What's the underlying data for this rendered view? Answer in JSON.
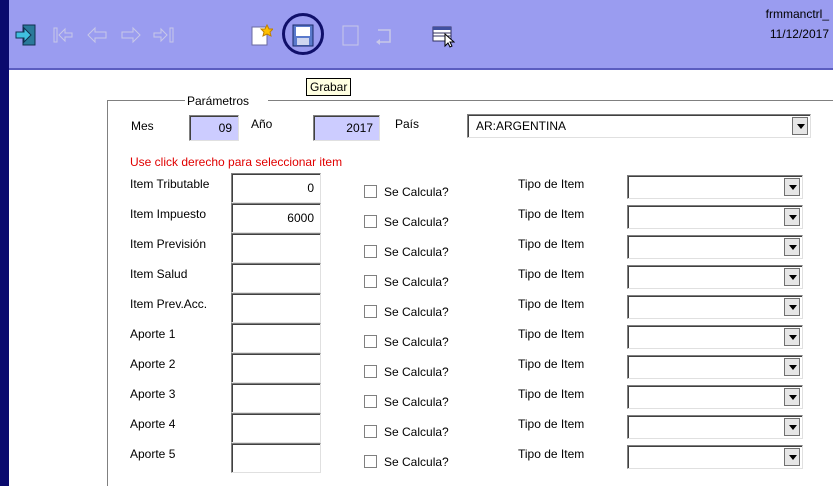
{
  "window": {
    "form_name": "frmmanctrl_",
    "date": "11/12/2017"
  },
  "toolbar": {
    "icons": [
      "exit-icon",
      "first-record-icon",
      "previous-record-icon",
      "next-record-icon",
      "last-record-icon",
      "new-record-icon",
      "save-icon",
      "blank-page-icon",
      "undo-icon",
      "grid-icon"
    ],
    "tooltip": "Grabar"
  },
  "params": {
    "group_title": "Parámetros",
    "mes_label": "Mes",
    "mes_value": "09",
    "anio_label": "Año",
    "anio_value": "2017",
    "pais_label": "País",
    "pais_value": "AR:ARGENTINA"
  },
  "hint": "Use click derecho para seleccionar item",
  "rows": [
    {
      "label": "Item Tributable",
      "value": "0",
      "calc": "Se Calcula?",
      "tipo": "Tipo de Item"
    },
    {
      "label": "Item Impuesto",
      "value": "6000",
      "calc": "Se Calcula?",
      "tipo": "Tipo de Item"
    },
    {
      "label": "Item Previsión",
      "value": "",
      "calc": "Se Calcula?",
      "tipo": "Tipo de Item"
    },
    {
      "label": "Item Salud",
      "value": "",
      "calc": "Se Calcula?",
      "tipo": "Tipo de Item"
    },
    {
      "label": "Item Prev.Acc.",
      "value": "",
      "calc": "Se Calcula?",
      "tipo": "Tipo de Item"
    },
    {
      "label": "Aporte 1",
      "value": "",
      "calc": "Se Calcula?",
      "tipo": "Tipo de Item"
    },
    {
      "label": "Aporte 2",
      "value": "",
      "calc": "Se Calcula?",
      "tipo": "Tipo de Item"
    },
    {
      "label": "Aporte 3",
      "value": "",
      "calc": "Se Calcula?",
      "tipo": "Tipo de Item"
    },
    {
      "label": "Aporte 4",
      "value": "",
      "calc": "Se Calcula?",
      "tipo": "Tipo de Item"
    },
    {
      "label": "Aporte 5",
      "value": "",
      "calc": "Se Calcula?",
      "tipo": "Tipo de Item"
    }
  ]
}
